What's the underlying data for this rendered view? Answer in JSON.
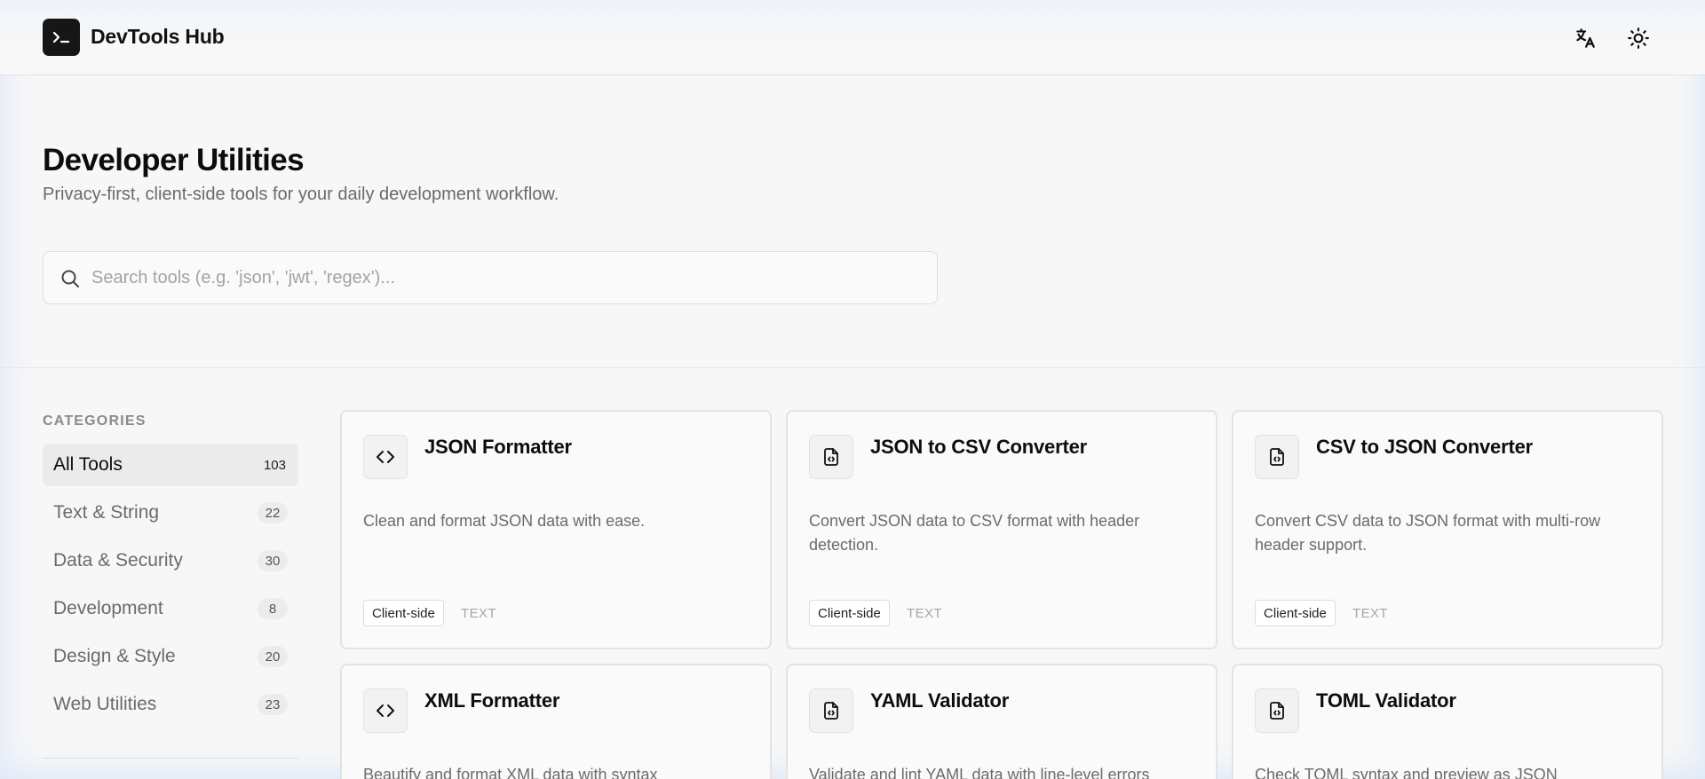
{
  "header": {
    "brand": "DevTools Hub",
    "logo_icon": "terminal-icon",
    "language_icon": "translate-icon",
    "theme_icon": "sun-icon"
  },
  "hero": {
    "title": "Developer Utilities",
    "subtitle": "Privacy-first, client-side tools for your daily development workflow.",
    "search": {
      "placeholder": "Search tools (e.g. 'json', 'jwt', 'regex')...",
      "value": ""
    }
  },
  "sidebar": {
    "heading": "CATEGORIES",
    "items": [
      {
        "label": "All Tools",
        "count": "103",
        "active": true
      },
      {
        "label": "Text & String",
        "count": "22",
        "active": false
      },
      {
        "label": "Data & Security",
        "count": "30",
        "active": false
      },
      {
        "label": "Development",
        "count": "8",
        "active": false
      },
      {
        "label": "Design & Style",
        "count": "20",
        "active": false
      },
      {
        "label": "Web Utilities",
        "count": "23",
        "active": false
      }
    ]
  },
  "tools": [
    {
      "title": "JSON Formatter",
      "description": "Clean and format JSON data with ease.",
      "tag": "Client-side",
      "type": "TEXT",
      "icon": "code-icon"
    },
    {
      "title": "JSON to CSV Converter",
      "description": "Convert JSON data to CSV format with header detection.",
      "tag": "Client-side",
      "type": "TEXT",
      "icon": "file-code-icon"
    },
    {
      "title": "CSV to JSON Converter",
      "description": "Convert CSV data to JSON format with multi-row header support.",
      "tag": "Client-side",
      "type": "TEXT",
      "icon": "file-code-icon"
    },
    {
      "title": "XML Formatter",
      "description": "Beautify and format XML data with syntax",
      "tag": "",
      "type": "",
      "icon": "code-icon"
    },
    {
      "title": "YAML Validator",
      "description": "Validate and lint YAML data with line-level errors",
      "tag": "",
      "type": "",
      "icon": "file-code-icon"
    },
    {
      "title": "TOML Validator",
      "description": "Check TOML syntax and preview as JSON",
      "tag": "",
      "type": "",
      "icon": "file-code-icon"
    }
  ],
  "colors": {
    "background": "#f7f7f7",
    "accent_dark": "#161616",
    "muted_text": "#6b6b6b",
    "border": "#e3e3e3"
  }
}
